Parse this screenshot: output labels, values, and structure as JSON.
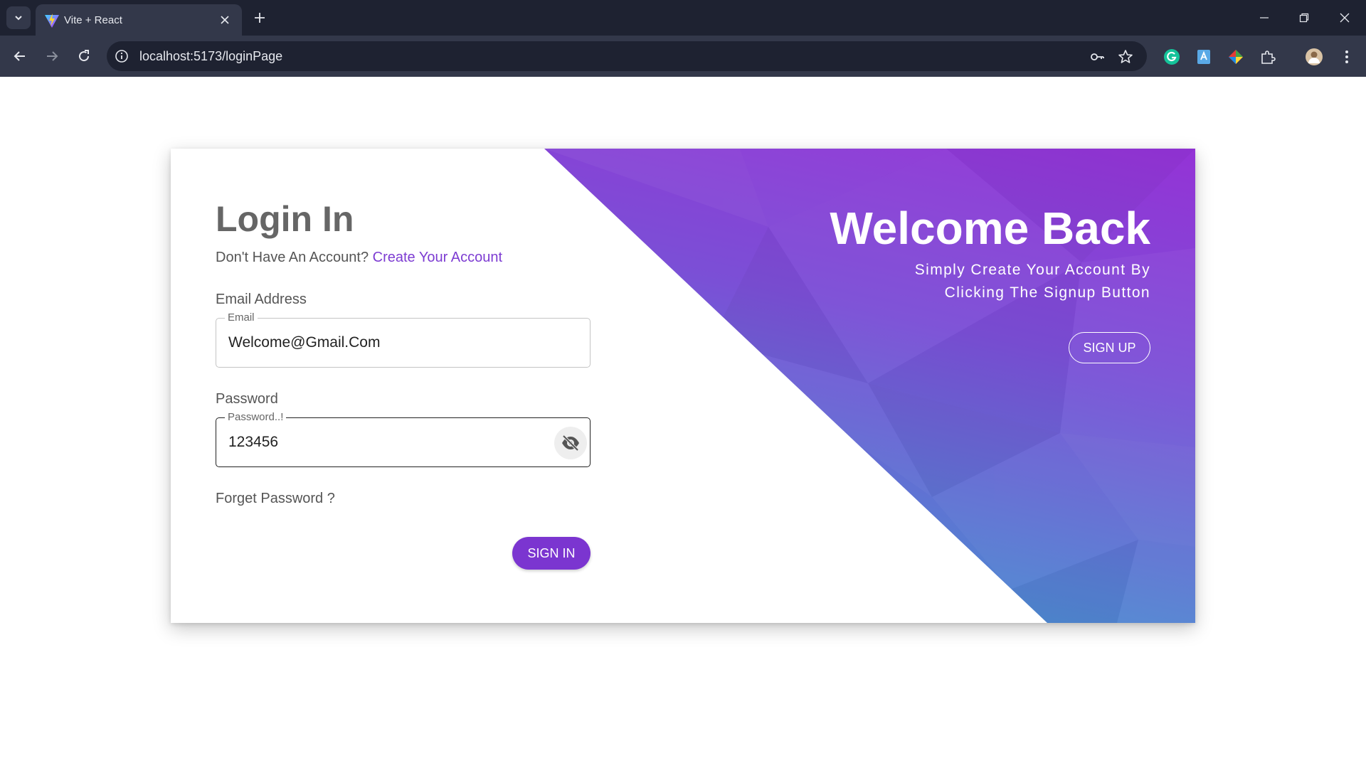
{
  "browser": {
    "tab_title": "Vite + React",
    "url": "localhost:5173/loginPage"
  },
  "login": {
    "title": "Login In",
    "prompt": "Don't Have An Account?",
    "create_link": "Create Your Account",
    "email_label": "Email Address",
    "email_float_label": "Email",
    "email_value": "Welcome@Gmail.Com",
    "password_label": "Password",
    "password_float_label": "Password..!",
    "password_value": "123456",
    "forget_password": "Forget Password ?",
    "signin_label": "SIGN IN"
  },
  "banner": {
    "heading": "Welcome Back",
    "subtext": "Simply Create Your Account By Clicking The Signup Button",
    "signup_label": "SIGN UP"
  },
  "colors": {
    "accent": "#7b35d0",
    "banner_top": "#8e2fd4",
    "banner_bottom": "#5a84d0"
  }
}
